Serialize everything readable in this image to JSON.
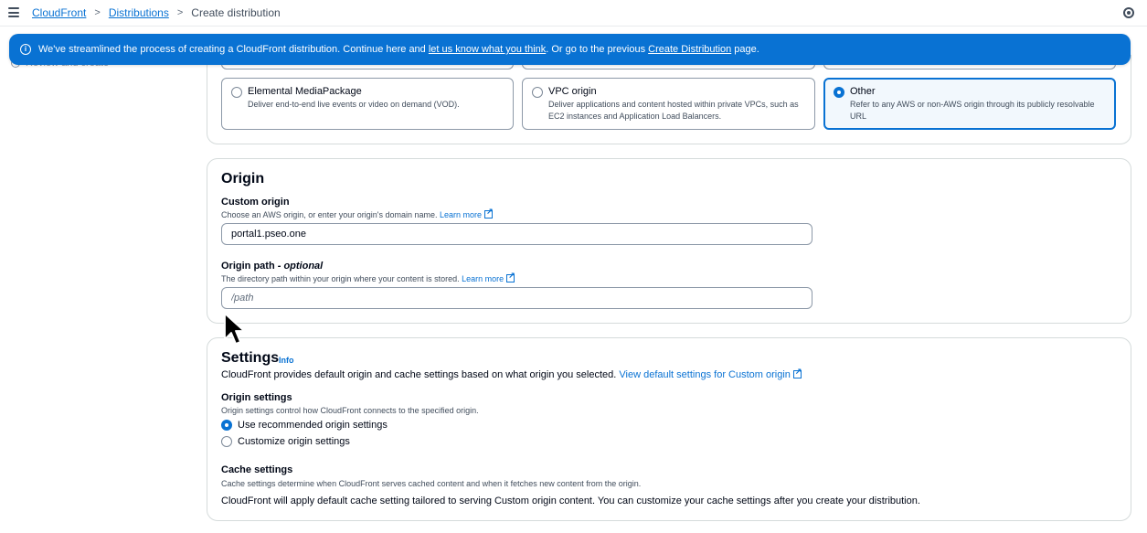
{
  "breadcrumb": {
    "items": [
      "CloudFront",
      "Distributions"
    ],
    "current": "Create distribution",
    "separator": ">"
  },
  "flash": {
    "text1": "We've streamlined the process of creating a CloudFront distribution. Continue here and ",
    "link1": "let us know what you think",
    "text2": ". Or go to the previous ",
    "link2": "Create Distribution",
    "text3": " page."
  },
  "sidebar": {
    "partial_item": "Review and create"
  },
  "origin_types": [
    {
      "title": "Elemental MediaPackage",
      "desc": "Deliver end-to-end live events or video on demand (VOD).",
      "selected": false
    },
    {
      "title": "VPC origin",
      "desc": "Deliver applications and content hosted within private VPCs, such as EC2 instances and Application Load Balancers.",
      "selected": false
    },
    {
      "title": "Other",
      "desc": "Refer to any AWS or non-AWS origin through its publicly resolvable URL",
      "selected": true
    }
  ],
  "origin": {
    "heading": "Origin",
    "custom_label": "Custom origin",
    "custom_desc": "Choose an AWS origin, or enter your origin's domain name.",
    "learn_more": "Learn more",
    "custom_value": "portal1.pseo.one",
    "path_label": "Origin path",
    "path_optional": " - optional",
    "path_desc": "The directory path within your origin where your content is stored.",
    "path_placeholder": "/path"
  },
  "settings": {
    "heading": "Settings",
    "info": "Info",
    "desc": "CloudFront provides default origin and cache settings based on what origin you selected.",
    "view_link": "View default settings for Custom origin",
    "origin_settings_label": "Origin settings",
    "origin_settings_desc": "Origin settings control how CloudFront connects to the specified origin.",
    "radio_recommended": "Use recommended origin settings",
    "radio_customize": "Customize origin settings",
    "cache_label": "Cache settings",
    "cache_desc": "Cache settings determine when CloudFront serves cached content and when it fetches new content from the origin.",
    "cache_body": "CloudFront will apply default cache setting tailored to serving Custom origin content. You can customize your cache settings after you create your distribution."
  },
  "colors": {
    "accent": "#0972d3",
    "border": "#8d99a8",
    "text": "#000716"
  }
}
